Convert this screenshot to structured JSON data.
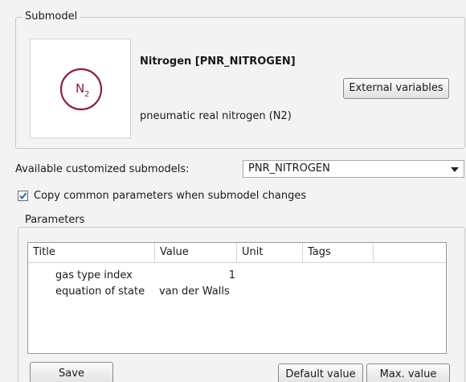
{
  "submodel": {
    "group_title": "Submodel",
    "icon_symbol": "N",
    "icon_subscript": "2",
    "icon_color": "#8b1a4a",
    "name": "Nitrogen [PNR_NITROGEN]",
    "description": "pneumatic real nitrogen (N2)",
    "external_variables_label": "External variables"
  },
  "customized": {
    "label": "Available customized submodels:",
    "selected": "PNR_NITROGEN"
  },
  "copy_params": {
    "label": "Copy common parameters when submodel changes",
    "checked": true
  },
  "parameters": {
    "group_title": "Parameters",
    "columns": [
      "Title",
      "Value",
      "Unit",
      "Tags"
    ],
    "rows": [
      {
        "title": "gas type index",
        "value": "1",
        "unit": "",
        "tags": ""
      },
      {
        "title": "equation of state",
        "value": "van der Walls",
        "unit": "",
        "tags": ""
      }
    ],
    "save_label": "Save",
    "default_value_label": "Default value",
    "max_value_label": "Max. value"
  }
}
